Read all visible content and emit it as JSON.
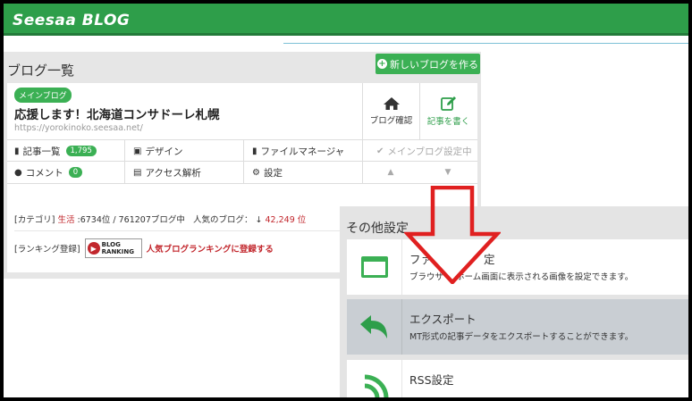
{
  "header": {
    "logo": "Seesaa BLOG"
  },
  "blog_list": {
    "title": "ブログ一覧",
    "new_blog_label": "新しいブログを作る",
    "main_badge": "メインブログ",
    "blog_title": "応援します！北海道コンサドーレ札幌",
    "blog_url": "https://yorokinoko.seesaa.net/",
    "blog_confirm_label": "ブログ確認",
    "write_article_label": "記事を書く",
    "articles_label": "記事一覧",
    "articles_count": "1,795",
    "design_label": "デザイン",
    "file_manager_label": "ファイルマネージャ",
    "main_blog_set_label": "メインブログ設定中",
    "comments_label": "コメント",
    "comments_count": "0",
    "access_label": "アクセス解析",
    "settings_label": "設定",
    "up_label": "▲",
    "down_label": "▼",
    "category_prefix": "[カテゴリ]",
    "category_name": "生活",
    "category_rank": ":6734位 / 761207ブログ中",
    "popularity_label": "人気のブログ：",
    "popularity_arrow": "↓",
    "popularity_rank": "42,249 位",
    "ranking_prefix": "[ランキング登録]",
    "ranking_logo_top": "BLOG",
    "ranking_logo_bottom": "RANKING",
    "ranking_link": "人気ブログランキングに登録する"
  },
  "other_settings": {
    "title": "その他設定",
    "rows": [
      {
        "title": "ファ",
        "title_tail": "定",
        "desc": "ブラウザ",
        "desc_tail": "ホーム画面に表示される画像を設定できます。"
      },
      {
        "title": "エクスポート",
        "desc": "MT形式の記事データをエクスポートすることができます。"
      },
      {
        "title": "RSS設定",
        "desc": ""
      }
    ]
  },
  "colors": {
    "brand_green": "#2e9e4a",
    "button_green": "#3bb054",
    "red": "#c2272d",
    "arrow_red": "#e02020"
  }
}
